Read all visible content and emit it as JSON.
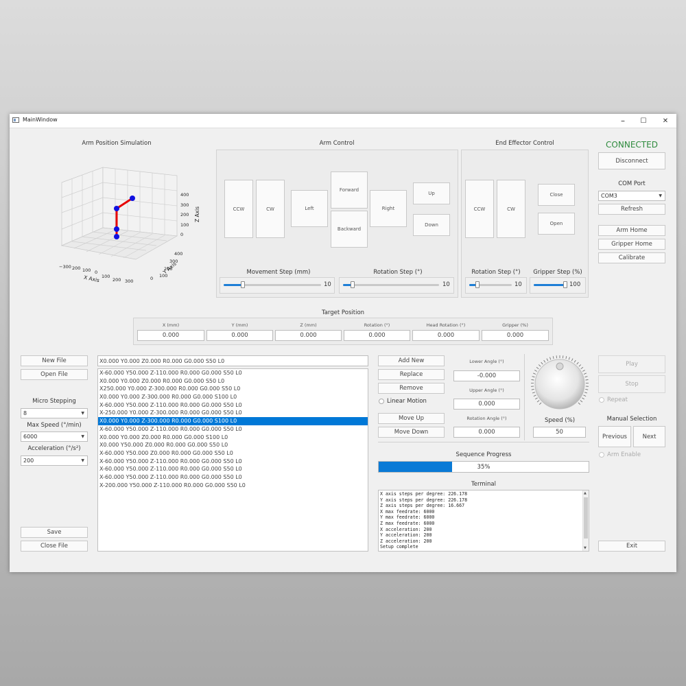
{
  "window": {
    "title": "MainWindow",
    "min": "–",
    "max": "☐",
    "close": "✕"
  },
  "sim": {
    "title": "Arm Position Simulation",
    "zlabel": "Z Axis",
    "ylabel": "Y Axis",
    "xlabel": "X Axis",
    "zticks": [
      "400",
      "300",
      "200",
      "100",
      "0"
    ],
    "yticks": [
      "400",
      "300",
      "200",
      "100",
      "0"
    ],
    "xticks": [
      "−300",
      "200",
      "100",
      "0",
      "100",
      "200",
      "300"
    ]
  },
  "arm_control": {
    "title": "Arm Control",
    "ccw": "CCW",
    "cw": "CW",
    "left": "Left",
    "forward": "Forward",
    "backward": "Backward",
    "right": "Right",
    "up": "Up",
    "down": "Down",
    "movement_step_label": "Movement Step (mm)",
    "movement_step_value": "10",
    "movement_step_fraction": 0.2,
    "rotation_step_label": "Rotation Step (°)",
    "rotation_step_value": "10",
    "rotation_step_fraction": 0.1
  },
  "end_effector": {
    "title": "End Effector Control",
    "ccw": "CCW",
    "cw": "CW",
    "close": "Close",
    "open": "Open",
    "rotation_step_label": "Rotation Step (°)",
    "rotation_step_value": "10",
    "rotation_step_fraction": 0.2,
    "gripper_step_label": "Gripper Step (%)",
    "gripper_step_value": "100",
    "gripper_step_fraction": 1.0
  },
  "connection": {
    "status": "CONNECTED",
    "status_color": "#2e8b3d",
    "disconnect": "Disconnect",
    "com_port_label": "COM Port",
    "com_port_value": "COM3",
    "refresh": "Refresh",
    "arm_home": "Arm Home",
    "gripper_home": "Gripper Home",
    "calibrate": "Calibrate"
  },
  "target": {
    "title": "Target Position",
    "fields": [
      {
        "label": "X (mm)",
        "value": "0.000"
      },
      {
        "label": "Y (mm)",
        "value": "0.000"
      },
      {
        "label": "Z (mm)",
        "value": "0.000"
      },
      {
        "label": "Rotation (°)",
        "value": "0.000"
      },
      {
        "label": "Head Rotation (°)",
        "value": "0.000"
      },
      {
        "label": "Gripper (%)",
        "value": "0.000"
      }
    ]
  },
  "file": {
    "new": "New File",
    "open": "Open File",
    "save": "Save",
    "close": "Close File",
    "micro_label": "Micro Stepping",
    "micro_value": "8",
    "speed_label": "Max Speed (°/min)",
    "speed_value": "6000",
    "accel_label": "Acceleration (°/s²)",
    "accel_value": "200"
  },
  "sequence": {
    "current": "X0.000 Y0.000 Z0.000 R0.000 G0.000 S50 L0",
    "selected_index": 6,
    "items": [
      "X-60.000 Y50.000 Z-110.000 R0.000 G0.000 S50 L0",
      "X0.000 Y0.000 Z0.000 R0.000 G0.000 S50 L0",
      "X250.000 Y0.000 Z-300.000 R0.000 G0.000 S50 L0",
      "X0.000 Y0.000 Z-300.000 R0.000 G0.000 S100 L0",
      "X-60.000 Y50.000 Z-110.000 R0.000 G0.000 S50 L0",
      "X-250.000 Y0.000 Z-300.000 R0.000 G0.000 S50 L0",
      "X0.000 Y0.000 Z-300.000 R0.000 G0.000 S100 L0",
      "X-60.000 Y50.000 Z-110.000 R0.000 G0.000 S50 L0",
      "X0.000 Y0.000 Z0.000 R0.000 G0.000 S100 L0",
      "X0.000 Y50.000 Z0.000 R0.000 G0.000 S50 L0",
      "X-60.000 Y50.000 Z0.000 R0.000 G0.000 S50 L0",
      "X-60.000 Y50.000 Z-110.000 R0.000 G0.000 S50 L0",
      "X-60.000 Y50.000 Z-110.000 R0.000 G0.000 S50 L0",
      "X-60.000 Y50.000 Z-110.000 R0.000 G0.000 S50 L0",
      "X-200.000 Y50.000 Z-110.000 R0.000 G0.000 S50 L0"
    ]
  },
  "seq_controls": {
    "add_new": "Add New",
    "replace": "Replace",
    "remove": "Remove",
    "linear_motion": "Linear Motion",
    "move_up": "Move Up",
    "move_down": "Move Down"
  },
  "angles": {
    "lower_label": "Lower Angle (°)",
    "lower_value": "-0.000",
    "upper_label": "Upper Angle (°)",
    "upper_value": "0.000",
    "rotation_label": "Rotation Angle (°)",
    "rotation_value": "0.000"
  },
  "speed": {
    "label": "Speed (%)",
    "value": "50"
  },
  "progress": {
    "label": "Sequence Progress",
    "text": "35%",
    "fraction": 0.35
  },
  "terminal": {
    "title": "Terminal",
    "lines": [
      "X axis steps per degree: 226.178",
      "Y axis steps per degree: 226.178",
      "Z axis steps per degree: 16.667",
      "X max feedrate: 6000",
      "Y max feedrate: 6000",
      "Z max feedrate: 6000",
      "X acceleration: 200",
      "Y acceleration: 200",
      "Z acceleration: 200",
      "Setup complete"
    ]
  },
  "playback": {
    "play": "Play",
    "stop": "Stop",
    "repeat": "Repeat",
    "manual_label": "Manual Selection",
    "previous": "Previous",
    "next": "Next",
    "arm_enable": "Arm Enable",
    "exit": "Exit"
  }
}
